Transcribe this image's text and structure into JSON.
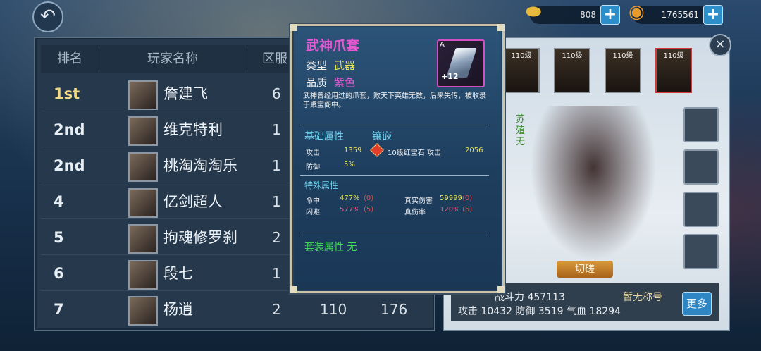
{
  "header": {
    "back_icon": "back-arrow-icon",
    "gold_ingot": {
      "icon": "gold-ingot-icon",
      "value": "808"
    },
    "coins": {
      "icon": "coin-icon",
      "value": "1765561"
    }
  },
  "ranking": {
    "columns": [
      "排名",
      "玩家名称",
      "区服"
    ],
    "rows": [
      {
        "rank": "1st",
        "name": "詹建飞",
        "server": "6",
        "c3": "",
        "c4": ""
      },
      {
        "rank": "2nd",
        "name": "维克特利",
        "server": "1",
        "c3": "",
        "c4": ""
      },
      {
        "rank": "2nd",
        "name": "桃淘淘淘乐",
        "server": "1",
        "c3": "",
        "c4": ""
      },
      {
        "rank": "4",
        "name": "亿剑超人",
        "server": "1",
        "c3": "",
        "c4": ""
      },
      {
        "rank": "5",
        "name": "拘魂修罗刹",
        "server": "2",
        "c3": "",
        "c4": ""
      },
      {
        "rank": "6",
        "name": "段七",
        "server": "1",
        "c3": "",
        "c4": ""
      },
      {
        "rank": "7",
        "name": "杨逍",
        "server": "2",
        "c3": "110",
        "c4": "176"
      }
    ]
  },
  "character": {
    "heroes": [
      {
        "level": "110级"
      },
      {
        "level": "110级"
      },
      {
        "level": "110级"
      },
      {
        "level": "110级"
      }
    ],
    "name_vertical": "苏殖无",
    "spar_button": "切磋",
    "power_line": "战斗力 457113",
    "title": "暂无称号",
    "stats_line": "攻击 10432 防御 3519 气血 18294",
    "more_button": "更多"
  },
  "tooltip": {
    "item_name": "武神爪套",
    "type_label": "类型",
    "type_value": "武器",
    "quality_label": "品质",
    "quality_value": "紫色",
    "icon_grade": "A",
    "icon_plus": "+12",
    "description": "武神曾经用过的爪套，败天下英雄无数，后来失传，被收录于聚宝阁中。",
    "base_title": "基础属性",
    "inlay_title": "镶嵌",
    "base_attrs": [
      {
        "label": "攻击",
        "value": "1359"
      },
      {
        "label": "防御",
        "value": "5%"
      }
    ],
    "inlay": {
      "gem": "10级红宝石",
      "attr": "攻击",
      "value": "2056"
    },
    "special_title": "特殊属性",
    "special": [
      {
        "label": "命中",
        "value": "477%",
        "extra": "(0)"
      },
      {
        "label": "闪避",
        "value": "577%",
        "extra": "(5)"
      },
      {
        "label": "真实伤害",
        "value": "59999",
        "extra": "(0)"
      },
      {
        "label": "真伤率",
        "value": "120%",
        "extra": "(6)"
      }
    ],
    "set_line": "套装属性 无"
  }
}
